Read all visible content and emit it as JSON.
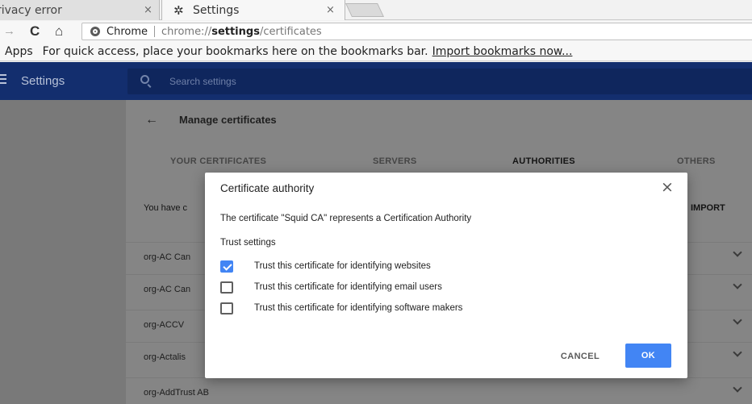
{
  "tabs": {
    "inactive": {
      "title": "rivacy error",
      "close": "×"
    },
    "active": {
      "title": "Settings",
      "close": "×"
    }
  },
  "nav": {
    "back": "→",
    "reload": "C",
    "home": "⌂"
  },
  "omnibox": {
    "chip_label": "Chrome",
    "url_prefix": "chrome://",
    "url_host": "settings",
    "url_path": "/certificates"
  },
  "bookmarks": {
    "apps_label": "Apps",
    "hint": "For quick access, place your bookmarks here on the bookmarks bar.",
    "import_link": "Import bookmarks now..."
  },
  "settings_header": {
    "title": "Settings",
    "search_placeholder": "Search settings"
  },
  "manage": {
    "back_arrow": "←",
    "title": "Manage certificates",
    "tabs": [
      "YOUR CERTIFICATES",
      "SERVERS",
      "AUTHORITIES",
      "OTHERS"
    ],
    "active_tab": "AUTHORITIES",
    "info_text": "You have c",
    "import_label": "IMPORT",
    "rows": [
      "org-AC Can",
      "org-AC Can",
      "org-ACCV",
      "org-Actalis",
      "org-AddTrust AB"
    ]
  },
  "dialog": {
    "title": "Certificate authority",
    "close": "×",
    "description": "The certificate \"Squid CA\" represents a Certification Authority",
    "trust_heading": "Trust settings",
    "options": [
      {
        "label": "Trust this certificate for identifying websites",
        "checked": true
      },
      {
        "label": "Trust this certificate for identifying email users",
        "checked": false
      },
      {
        "label": "Trust this certificate for identifying software makers",
        "checked": false
      }
    ],
    "cancel_label": "CANCEL",
    "ok_label": "OK"
  },
  "colors": {
    "header_bg": "#132e6e",
    "accent": "#4285f4",
    "overlay": "#797979"
  }
}
